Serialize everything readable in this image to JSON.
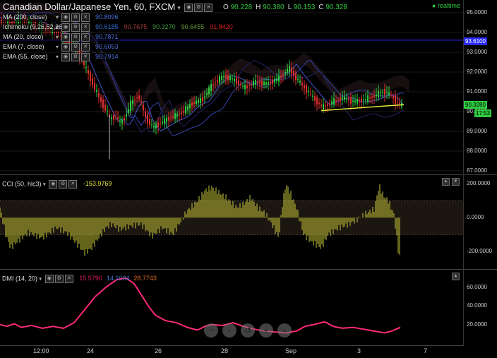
{
  "header": {
    "symbol_title": "Canadian Dollar/Japanese Yen, 60, FXCM",
    "ohlc": [
      {
        "key": "O",
        "value": "90.228"
      },
      {
        "key": "H",
        "value": "90.380"
      },
      {
        "key": "L",
        "value": "90.153"
      },
      {
        "key": "C",
        "value": "90.328"
      }
    ],
    "realtime_label": "realtime"
  },
  "indicators": [
    {
      "label": "MA (200, close)",
      "values": [
        {
          "text": "90.8096",
          "color": "#4a6cd4"
        }
      ]
    },
    {
      "label": "Ichimoku (9,26,52,26)",
      "values": [
        {
          "text": "90.6185",
          "color": "#2f6fd0"
        },
        {
          "text": "90.7675",
          "color": "#a03a3a"
        },
        {
          "text": "90.3270",
          "color": "#3a9a3a"
        },
        {
          "text": "90.6455",
          "color": "#6a9a3a"
        },
        {
          "text": "91.8420",
          "color": "#d02020"
        }
      ]
    },
    {
      "label": "MA (20, close)",
      "values": [
        {
          "text": "90.7871",
          "color": "#4a6cd4"
        }
      ]
    },
    {
      "label": "EMA (7, close)",
      "values": [
        {
          "text": "90.6053",
          "color": "#4a6cd4"
        }
      ]
    },
    {
      "label": "EMA (55, close)",
      "values": [
        {
          "text": "90.7914",
          "color": "#4a6cd4"
        }
      ]
    }
  ],
  "price_axis": {
    "ticks": [
      "95.0000",
      "94.0000",
      "93.0000",
      "92.0000",
      "91.0000",
      "90.0000",
      "89.0000",
      "88.0000",
      "87.0000"
    ],
    "hline_label": "93.6100",
    "last_label": "90.3280",
    "countdown_label": "17:53"
  },
  "cci": {
    "title": "CCI (50, hlc3)",
    "value": "-153.9769",
    "ticks": [
      "200.0000",
      "0.0000",
      "-200.0000"
    ]
  },
  "dmi": {
    "title": "DMI (14, 20)",
    "values": [
      {
        "text": "15.5790",
        "color": "#e0206a"
      },
      {
        "text": "14.1034",
        "color": "#3a7ad0"
      },
      {
        "text": "28.7743",
        "color": "#e06a20"
      }
    ],
    "ticks": [
      "60.0000",
      "40.0000",
      "20.0000"
    ]
  },
  "time_axis": [
    "12:00",
    "24",
    "26",
    "28",
    "Sep",
    "3",
    "7"
  ],
  "zoom_controls": [
    "minus-icon",
    "scroll-left-icon",
    "reset-icon",
    "plus-icon",
    "scroll-right-icon"
  ],
  "colors": {
    "up": "#2ecc40",
    "down": "#e03030",
    "cci": "#c8c83a",
    "dmi": "#ff2a7a",
    "trendline": "#e8e83a",
    "hline": "#2a2aff"
  },
  "chart_data": [
    {
      "type": "candlestick",
      "title": "Canadian Dollar/Japanese Yen, 60, FXCM",
      "ylim": [
        87.0,
        95.0
      ],
      "close_path": [
        [
          0,
          94.6
        ],
        [
          15,
          94.5
        ],
        [
          30,
          94.7
        ],
        [
          45,
          94.4
        ],
        [
          60,
          94.2
        ],
        [
          75,
          94.0
        ],
        [
          90,
          93.7
        ],
        [
          105,
          93.2
        ],
        [
          115,
          92.6
        ],
        [
          125,
          91.8
        ],
        [
          135,
          91.0
        ],
        [
          145,
          90.3
        ],
        [
          155,
          89.6
        ],
        [
          162,
          89.8
        ],
        [
          170,
          89.4
        ],
        [
          178,
          89.9
        ],
        [
          185,
          90.5
        ],
        [
          195,
          90.8
        ],
        [
          205,
          89.7
        ],
        [
          215,
          89.2
        ],
        [
          225,
          89.4
        ],
        [
          240,
          89.7
        ],
        [
          255,
          89.9
        ],
        [
          270,
          90.4
        ],
        [
          285,
          90.6
        ],
        [
          300,
          91.4
        ],
        [
          315,
          91.8
        ],
        [
          330,
          91.6
        ],
        [
          345,
          91.2
        ],
        [
          360,
          91.5
        ],
        [
          375,
          91.4
        ],
        [
          390,
          91.6
        ],
        [
          400,
          91.9
        ],
        [
          408,
          92.2
        ],
        [
          418,
          91.7
        ],
        [
          430,
          91.2
        ],
        [
          440,
          90.8
        ],
        [
          455,
          90.2
        ],
        [
          470,
          90.5
        ],
        [
          485,
          90.7
        ],
        [
          500,
          90.5
        ],
        [
          515,
          90.6
        ],
        [
          530,
          90.8
        ],
        [
          540,
          91.0
        ],
        [
          550,
          90.9
        ],
        [
          560,
          90.5
        ],
        [
          568,
          90.3
        ]
      ],
      "wick_low": {
        "x": 155,
        "y": 87.6
      },
      "horizontal_line": 93.61,
      "trendline": [
        [
          455,
          90.05
        ],
        [
          572,
          90.35
        ]
      ]
    },
    {
      "type": "bar",
      "title": "CCI (50, hlc3)",
      "ylim": [
        -270,
        230
      ],
      "bands": [
        100,
        -100
      ],
      "profile": [
        [
          0,
          60
        ],
        [
          8,
          -100
        ],
        [
          15,
          -180
        ],
        [
          25,
          -140
        ],
        [
          40,
          -90
        ],
        [
          60,
          -120
        ],
        [
          80,
          -60
        ],
        [
          95,
          -90
        ],
        [
          110,
          -160
        ],
        [
          120,
          -210
        ],
        [
          130,
          -180
        ],
        [
          140,
          -120
        ],
        [
          150,
          -60
        ],
        [
          158,
          -40
        ],
        [
          170,
          -70
        ],
        [
          185,
          -50
        ],
        [
          200,
          -40
        ],
        [
          215,
          -110
        ],
        [
          230,
          -60
        ],
        [
          245,
          -100
        ],
        [
          255,
          -30
        ],
        [
          265,
          40
        ],
        [
          280,
          100
        ],
        [
          290,
          160
        ],
        [
          300,
          180
        ],
        [
          310,
          150
        ],
        [
          320,
          120
        ],
        [
          335,
          60
        ],
        [
          345,
          80
        ],
        [
          355,
          120
        ],
        [
          365,
          60
        ],
        [
          375,
          30
        ],
        [
          385,
          -40
        ],
        [
          395,
          -120
        ],
        [
          400,
          80
        ],
        [
          405,
          200
        ],
        [
          412,
          140
        ],
        [
          420,
          60
        ],
        [
          430,
          -100
        ],
        [
          440,
          -140
        ],
        [
          455,
          -180
        ],
        [
          465,
          -100
        ],
        [
          480,
          -60
        ],
        [
          495,
          -40
        ],
        [
          510,
          0
        ],
        [
          520,
          30
        ],
        [
          530,
          50
        ],
        [
          537,
          190
        ],
        [
          543,
          130
        ],
        [
          550,
          100
        ],
        [
          558,
          20
        ],
        [
          565,
          -230
        ]
      ]
    },
    {
      "type": "line",
      "title": "DMI (14, 20)",
      "ylim": [
        0,
        75
      ],
      "series": [
        {
          "values": [
            [
              0,
              20
            ],
            [
              10,
              18
            ],
            [
              20,
              21
            ],
            [
              30,
              17
            ],
            [
              45,
              19
            ],
            [
              60,
              16
            ],
            [
              75,
              18
            ],
            [
              90,
              16
            ],
            [
              105,
              22
            ],
            [
              120,
              36
            ],
            [
              135,
              50
            ],
            [
              150,
              60
            ],
            [
              165,
              68
            ],
            [
              178,
              70
            ],
            [
              190,
              64
            ],
            [
              200,
              52
            ],
            [
              210,
              40
            ],
            [
              220,
              30
            ],
            [
              235,
              24
            ],
            [
              250,
              22
            ],
            [
              265,
              17
            ],
            [
              280,
              14
            ],
            [
              290,
              18
            ],
            [
              300,
              20
            ],
            [
              315,
              19
            ],
            [
              330,
              22
            ],
            [
              345,
              18
            ],
            [
              360,
              15
            ],
            [
              375,
              13
            ],
            [
              390,
              12
            ],
            [
              405,
              11
            ],
            [
              420,
              13
            ],
            [
              432,
              18
            ],
            [
              445,
              20
            ],
            [
              460,
              23
            ],
            [
              472,
              18
            ],
            [
              485,
              16
            ],
            [
              500,
              17
            ],
            [
              515,
              15
            ],
            [
              530,
              13
            ],
            [
              545,
              11
            ],
            [
              555,
              13
            ],
            [
              567,
              17
            ]
          ]
        }
      ]
    }
  ]
}
